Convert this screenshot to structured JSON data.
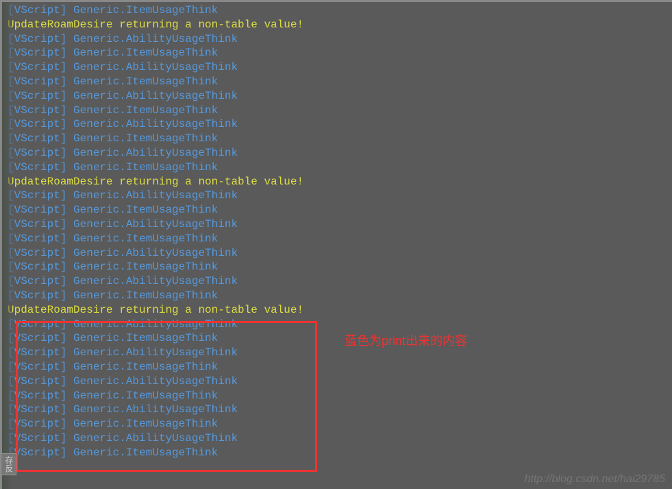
{
  "console": {
    "lines": [
      {
        "type": "vscript",
        "text": "[VScript] Generic.ItemUsageThink"
      },
      {
        "type": "warning",
        "text": "UpdateRoamDesire returning a non-table value!"
      },
      {
        "type": "vscript",
        "text": "[VScript] Generic.AbilityUsageThink"
      },
      {
        "type": "vscript",
        "text": "[VScript] Generic.ItemUsageThink"
      },
      {
        "type": "vscript",
        "text": "[VScript] Generic.AbilityUsageThink"
      },
      {
        "type": "vscript",
        "text": "[VScript] Generic.ItemUsageThink"
      },
      {
        "type": "vscript",
        "text": "[VScript] Generic.AbilityUsageThink"
      },
      {
        "type": "vscript",
        "text": "[VScript] Generic.ItemUsageThink"
      },
      {
        "type": "vscript",
        "text": "[VScript] Generic.AbilityUsageThink"
      },
      {
        "type": "vscript",
        "text": "[VScript] Generic.ItemUsageThink"
      },
      {
        "type": "vscript",
        "text": "[VScript] Generic.AbilityUsageThink"
      },
      {
        "type": "vscript",
        "text": "[VScript] Generic.ItemUsageThink"
      },
      {
        "type": "warning",
        "text": "UpdateRoamDesire returning a non-table value!"
      },
      {
        "type": "vscript",
        "text": "[VScript] Generic.AbilityUsageThink"
      },
      {
        "type": "vscript",
        "text": "[VScript] Generic.ItemUsageThink"
      },
      {
        "type": "vscript",
        "text": "[VScript] Generic.AbilityUsageThink"
      },
      {
        "type": "vscript",
        "text": "[VScript] Generic.ItemUsageThink"
      },
      {
        "type": "vscript",
        "text": "[VScript] Generic.AbilityUsageThink"
      },
      {
        "type": "vscript",
        "text": "[VScript] Generic.ItemUsageThink"
      },
      {
        "type": "vscript",
        "text": "[VScript] Generic.AbilityUsageThink"
      },
      {
        "type": "vscript",
        "text": "[VScript] Generic.ItemUsageThink"
      },
      {
        "type": "warning",
        "text": "UpdateRoamDesire returning a non-table value!"
      },
      {
        "type": "vscript",
        "text": "[VScript] Generic.AbilityUsageThink"
      },
      {
        "type": "vscript",
        "text": "[VScript] Generic.ItemUsageThink"
      },
      {
        "type": "vscript",
        "text": "[VScript] Generic.AbilityUsageThink"
      },
      {
        "type": "vscript",
        "text": "[VScript] Generic.ItemUsageThink"
      },
      {
        "type": "vscript",
        "text": "[VScript] Generic.AbilityUsageThink"
      },
      {
        "type": "vscript",
        "text": "[VScript] Generic.ItemUsageThink"
      },
      {
        "type": "vscript",
        "text": "[VScript] Generic.AbilityUsageThink"
      },
      {
        "type": "vscript",
        "text": "[VScript] Generic.ItemUsageThink"
      },
      {
        "type": "vscript",
        "text": "[VScript] Generic.AbilityUsageThink"
      },
      {
        "type": "vscript",
        "text": "[VScript] Generic.ItemUsageThink"
      }
    ]
  },
  "annotation": {
    "text": "蓝色为print出来的内容"
  },
  "watermark": {
    "text": "http://blog.csdn.net/hai29785"
  },
  "sideTab": {
    "text": "存反"
  }
}
